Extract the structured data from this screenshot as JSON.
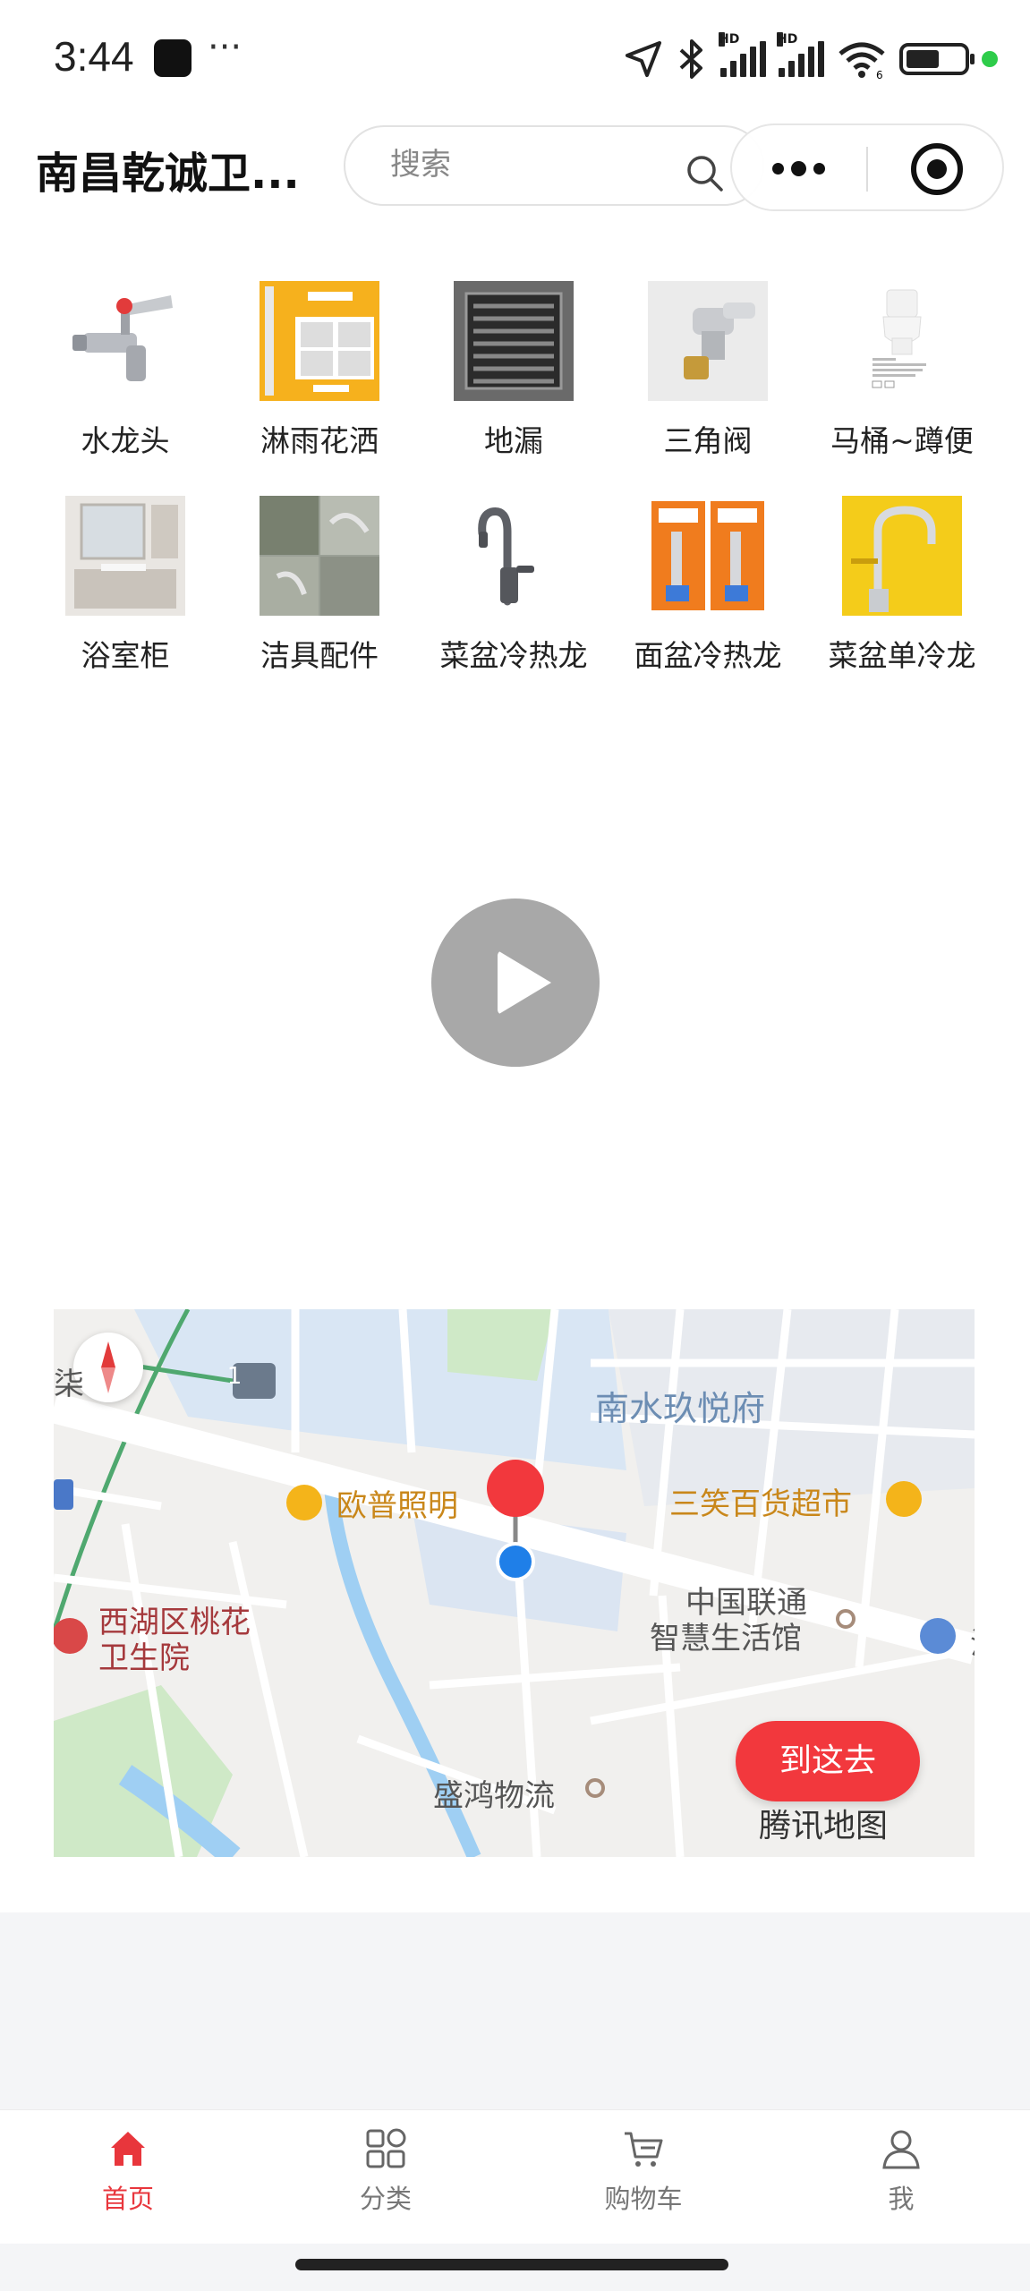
{
  "status_bar": {
    "time": "3:44",
    "dots": "···",
    "signal_1": "HD",
    "signal_2": "HD",
    "wifi_badge": "6"
  },
  "header": {
    "title": "南昌乾诚卫...",
    "search_placeholder": "搜索"
  },
  "categories": [
    {
      "label": "水龙头",
      "icon": "faucet-image"
    },
    {
      "label": "淋雨花洒",
      "icon": "shower-set-image"
    },
    {
      "label": "地漏",
      "icon": "floor-drain-image"
    },
    {
      "label": "三角阀",
      "icon": "angle-valve-image"
    },
    {
      "label": "马桶~蹲便",
      "icon": "toilet-image"
    },
    {
      "label": "浴室柜",
      "icon": "bathroom-cabinet-image"
    },
    {
      "label": "洁具配件",
      "icon": "sanitary-parts-image"
    },
    {
      "label": "菜盆冷热龙",
      "icon": "kitchen-faucet-image"
    },
    {
      "label": "面盆冷热龙",
      "icon": "basin-faucet-image"
    },
    {
      "label": "菜盆单冷龙",
      "icon": "single-cold-faucet-image"
    }
  ],
  "map": {
    "labels": {
      "residential": "南水玖悦府",
      "lighting_store": "欧普照明",
      "supermarket": "三笑百货超市",
      "unicom_line1": "中国联通",
      "unicom_line2": "智慧生活馆",
      "hospital_line1": "西湖区桃花",
      "hospital_line2": "卫生院",
      "logistics": "盛鸿物流",
      "road_badge": "1",
      "edge_left": "柒",
      "edge_right": "汽"
    },
    "route_button": "到这去",
    "watermark": "腾讯地图",
    "colors": {
      "water": "#d9e6f4",
      "park": "#cfe9c7",
      "road": "#ffffff",
      "river": "#9fcff3"
    }
  },
  "tabbar": [
    {
      "label": "首页",
      "icon": "home-icon",
      "active": true
    },
    {
      "label": "分类",
      "icon": "grid-icon",
      "active": false
    },
    {
      "label": "购物车",
      "icon": "cart-icon",
      "active": false
    },
    {
      "label": "我",
      "icon": "user-icon",
      "active": false
    }
  ],
  "accent_color": "#e8363c"
}
